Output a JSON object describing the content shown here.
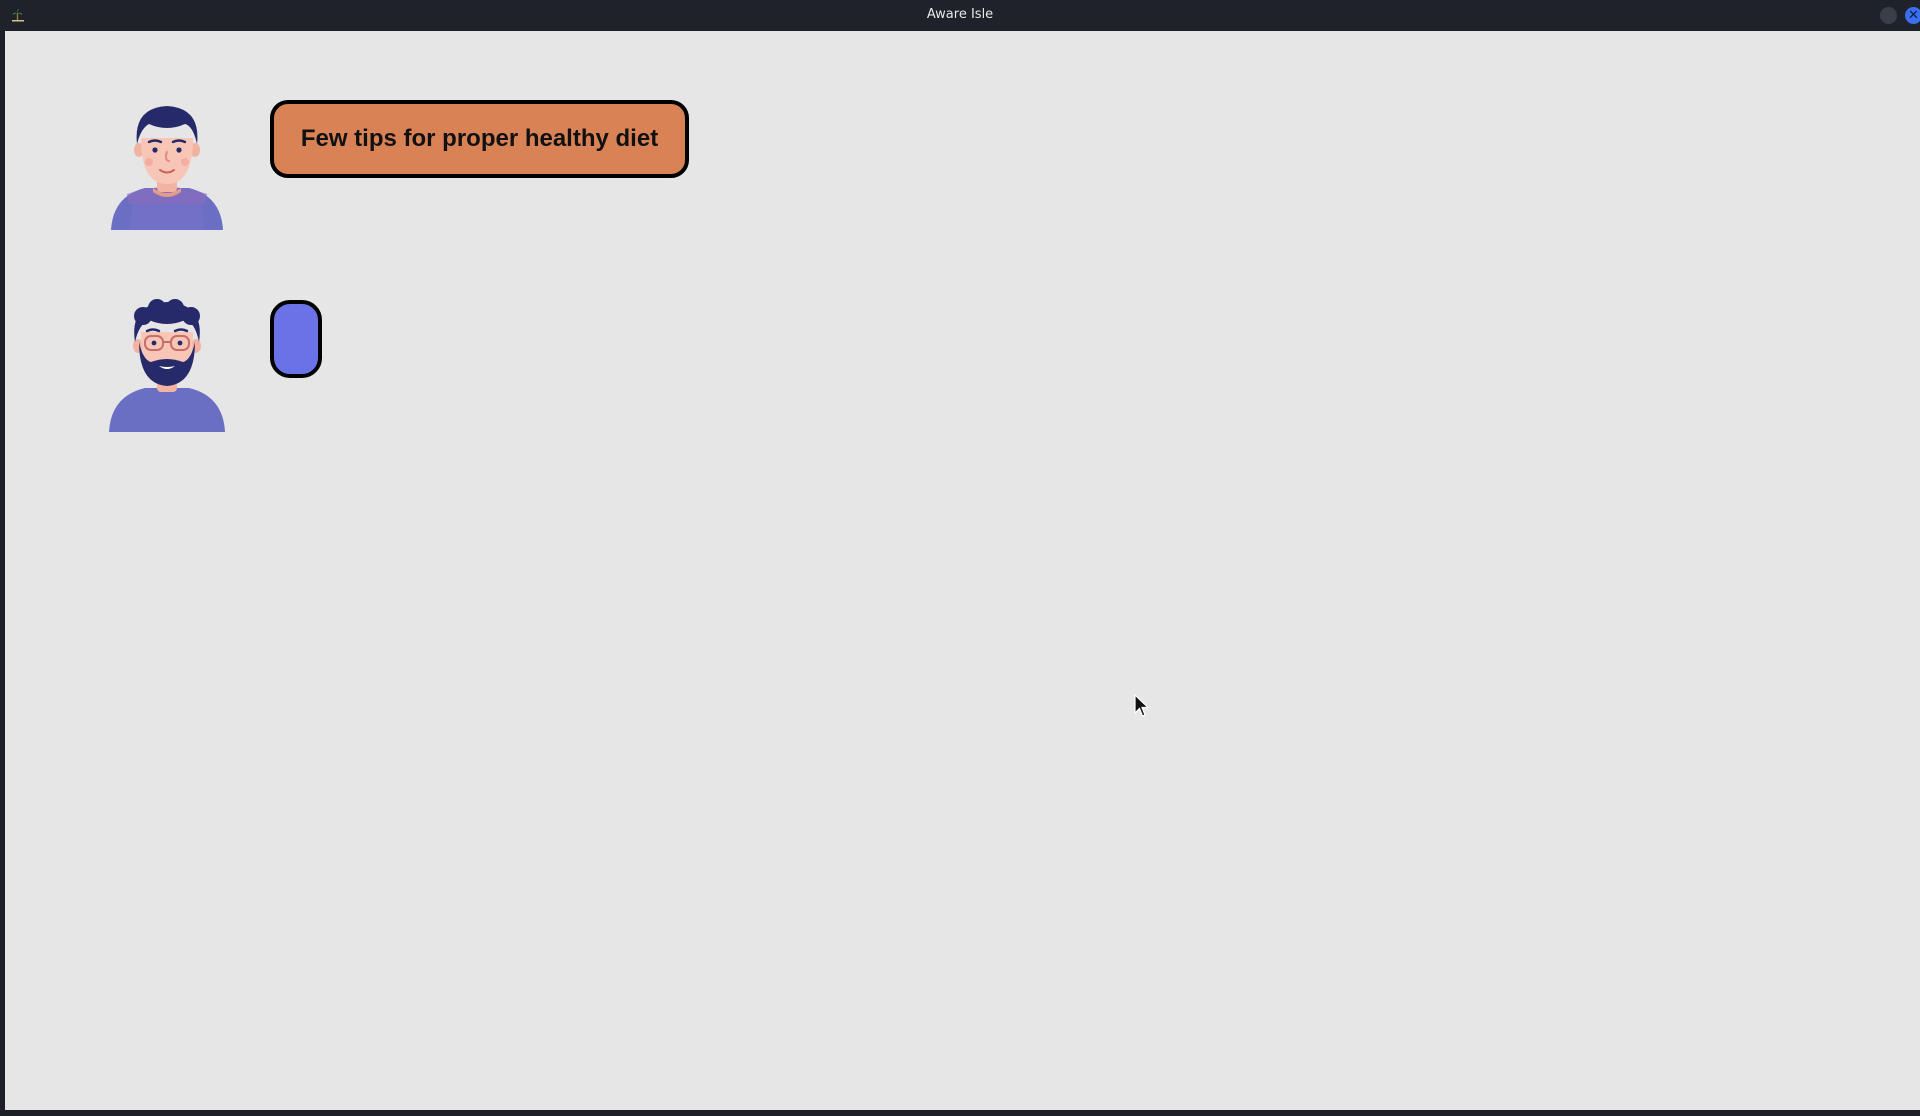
{
  "window": {
    "title": "Aware Isle",
    "icons": {
      "app": "island-app-icon",
      "minimize": "circle-icon",
      "close": "close-icon"
    },
    "close_glyph": "✕"
  },
  "chat": {
    "messages": [
      {
        "avatar": "man-avatar-icon",
        "text": "Few tips for proper healthy diet",
        "bubble_color": "#d98256"
      },
      {
        "avatar": "bearded-man-glasses-avatar-icon",
        "text": "",
        "bubble_color": "#6b72e8"
      }
    ]
  },
  "colors": {
    "background": "#e6e6e6",
    "titlebar": "#1f222b",
    "accent_close": "#3b6ff0"
  }
}
